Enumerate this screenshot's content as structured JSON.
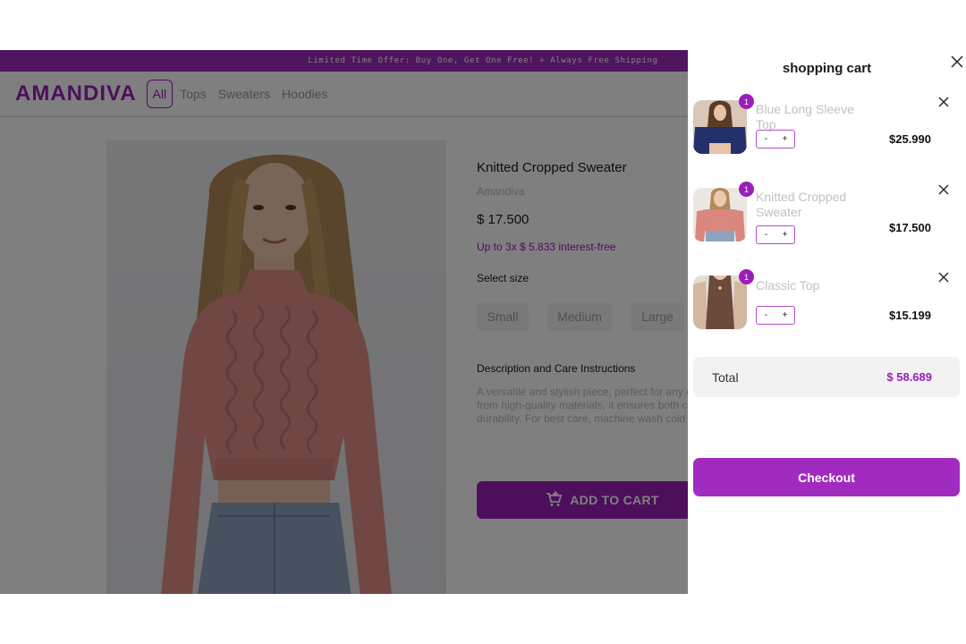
{
  "promo": {
    "text": "Limited Time Offer: Buy One, Get One Free! + Always Free Shipping"
  },
  "header": {
    "logo": "AMANDIVA",
    "nav": [
      {
        "label": "All",
        "active": true
      },
      {
        "label": "Tops"
      },
      {
        "label": "Sweaters"
      },
      {
        "label": "Hoodies"
      }
    ]
  },
  "product": {
    "title": "Knitted Cropped Sweater",
    "brand": "Amandiva",
    "price": "$ 17.500",
    "installment": "Up to 3x $ 5.833 interest-free",
    "size_label": "Select size",
    "sizes": [
      "Small",
      "Medium",
      "Large"
    ],
    "desc_label": "Description and Care Instructions",
    "description": "A versatile and stylish piece, perfect for any occasion. Crafted from high-quality materials, it ensures both comfort and durability. For best care, machine wash cold and hang to dry.",
    "add_to_cart": "ADD TO CART"
  },
  "cart": {
    "title": "shopping cart",
    "items": [
      {
        "name": "Blue Long Sleeve Top",
        "qty": "1",
        "minus": "-",
        "plus": "+",
        "price": "$25.990",
        "color": "#23306a"
      },
      {
        "name": "Knitted Cropped Sweater",
        "qty": "1",
        "minus": "-",
        "plus": "+",
        "price": "$17.500",
        "color": "#d98a84"
      },
      {
        "name": "Classic Top",
        "qty": "1",
        "minus": "-",
        "plus": "+",
        "price": "$15.199",
        "color": "#6b4a3c"
      }
    ],
    "total_label": "Total",
    "total_value": "$ 58.689",
    "checkout_label": "Checkout"
  },
  "colors": {
    "brand": "#9a1fb8",
    "overlay": "rgba(0,0,0,0.5)"
  }
}
